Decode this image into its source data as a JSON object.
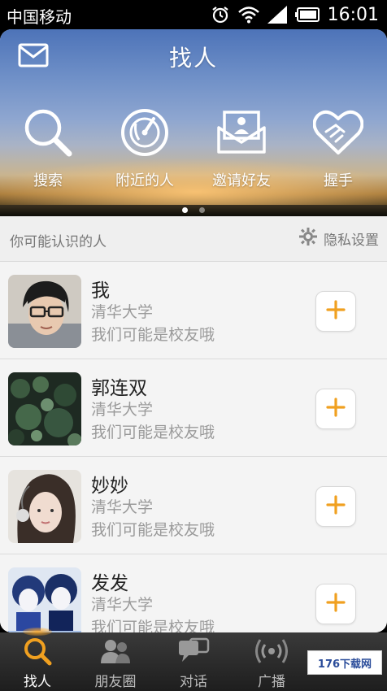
{
  "status_bar": {
    "carrier": "中国移动",
    "time": "16:01",
    "icons": [
      "alarm-icon",
      "wifi-icon",
      "signal-icon",
      "battery-icon"
    ]
  },
  "header": {
    "title": "找人",
    "mail_icon": "mail-icon",
    "actions": [
      {
        "label": "搜索",
        "icon": "search-icon"
      },
      {
        "label": "附近的人",
        "icon": "radar-icon"
      },
      {
        "label": "邀请好友",
        "icon": "invite-card-icon"
      },
      {
        "label": "握手",
        "icon": "handshake-heart-icon"
      }
    ],
    "page_indicator": {
      "pages": 2,
      "active": 1
    }
  },
  "section": {
    "title": "你可能认识的人",
    "privacy_label": "隐私设置"
  },
  "people": [
    {
      "name": "我",
      "school": "清华大学",
      "reason": "我们可能是校友哦"
    },
    {
      "name": "郭连双",
      "school": "清华大学",
      "reason": "我们可能是校友哦"
    },
    {
      "name": "妙妙",
      "school": "清华大学",
      "reason": "我们可能是校友哦"
    },
    {
      "name": "发发",
      "school": "清华大学",
      "reason": "我们可能是校友哦"
    }
  ],
  "tabbar": {
    "tabs": [
      {
        "label": "找人",
        "icon": "search-icon",
        "active": true
      },
      {
        "label": "朋友圈",
        "icon": "friends-icon",
        "active": false
      },
      {
        "label": "对话",
        "icon": "chat-icon",
        "active": false
      },
      {
        "label": "广播",
        "icon": "broadcast-icon",
        "active": false
      }
    ],
    "watermark": "176下载网"
  },
  "colors": {
    "accent": "#f0a020",
    "text_primary": "#222222",
    "text_secondary": "#9a9a9a"
  }
}
